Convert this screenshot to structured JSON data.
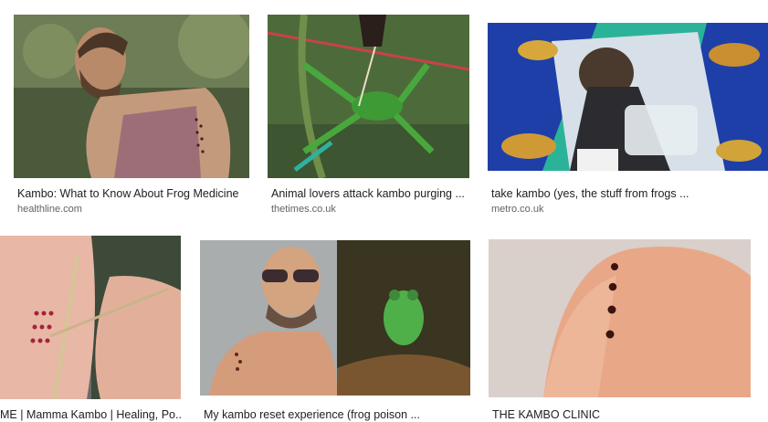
{
  "results": [
    {
      "title": "Kambo: What to Know About Frog Medicine",
      "source": "healthline.com",
      "image": "man-shoulder-kambo-dots-photo"
    },
    {
      "title": "Animal lovers attack kambo purging ...",
      "source": "thetimes.co.uk",
      "image": "green-frog-held-photo"
    },
    {
      "title": "take kambo (yes, the stuff from frogs ...",
      "source": "metro.co.uk",
      "image": "woman-purging-bucket-frogs-photo"
    },
    {
      "title": "ME | Mamma Kambo | Healing, Po...",
      "source": "",
      "image": "arm-burn-points-stick-photo"
    },
    {
      "title": "My kambo reset experience (frog poison ...",
      "source": "",
      "image": "man-sunglasses-and-frog-photo"
    },
    {
      "title": "THE KAMBO CLINIC",
      "source": "",
      "image": "shoulder-four-dots-photo"
    }
  ],
  "colors": {
    "title_text": "#202124",
    "source_text": "#5f6368"
  }
}
